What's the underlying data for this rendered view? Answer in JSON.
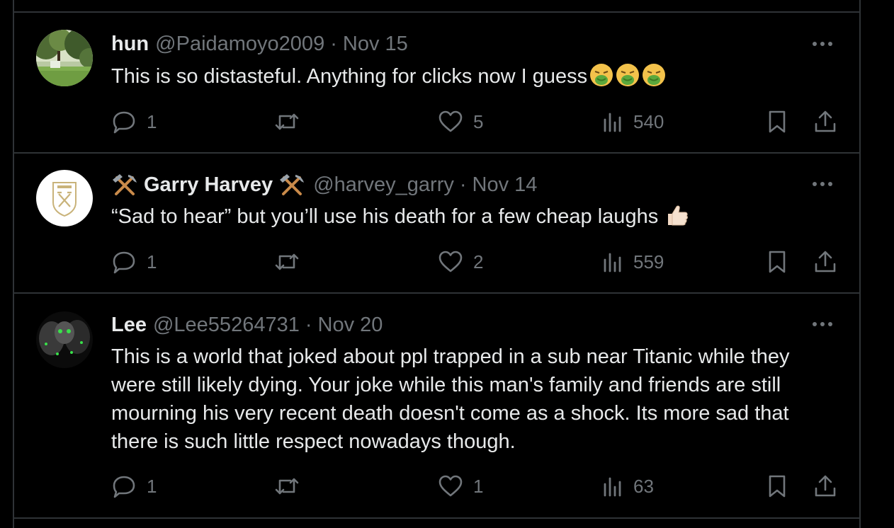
{
  "colors": {
    "background": "#000000",
    "divider": "#2f3336",
    "primary_text": "#e7e9ea",
    "secondary_text": "#71767b"
  },
  "tweets": [
    {
      "display_name": "hun",
      "handle": "@Paidamoyo2009",
      "separator": "·",
      "date": "Nov 15",
      "text": "This is so distasteful.  Anything for clicks now I guess",
      "emojis": [
        "nauseated-face",
        "nauseated-face",
        "nauseated-face"
      ],
      "replies": "1",
      "retweets": "",
      "likes": "5",
      "views": "540"
    },
    {
      "display_name": "Garry Harvey",
      "name_icons": [
        "hammer-and-pick",
        "hammer-and-pick"
      ],
      "handle": "@harvey_garry",
      "separator": "·",
      "date": "Nov 14",
      "text": "“Sad to hear” but you’ll use his death for a few cheap laughs",
      "emojis": [
        "thumbs-up"
      ],
      "replies": "1",
      "retweets": "",
      "likes": "2",
      "views": "559"
    },
    {
      "display_name": "Lee",
      "handle": "@Lee55264731",
      "separator": "·",
      "date": "Nov 20",
      "text": "This is a world that joked about ppl trapped in a sub near Titanic while they were still likely dying. Your joke while this man's family and friends are still mourning his very recent death doesn't come as a shock. Its more sad that there is such little respect nowadays though.",
      "replies": "1",
      "retweets": "",
      "likes": "1",
      "views": "63"
    }
  ]
}
